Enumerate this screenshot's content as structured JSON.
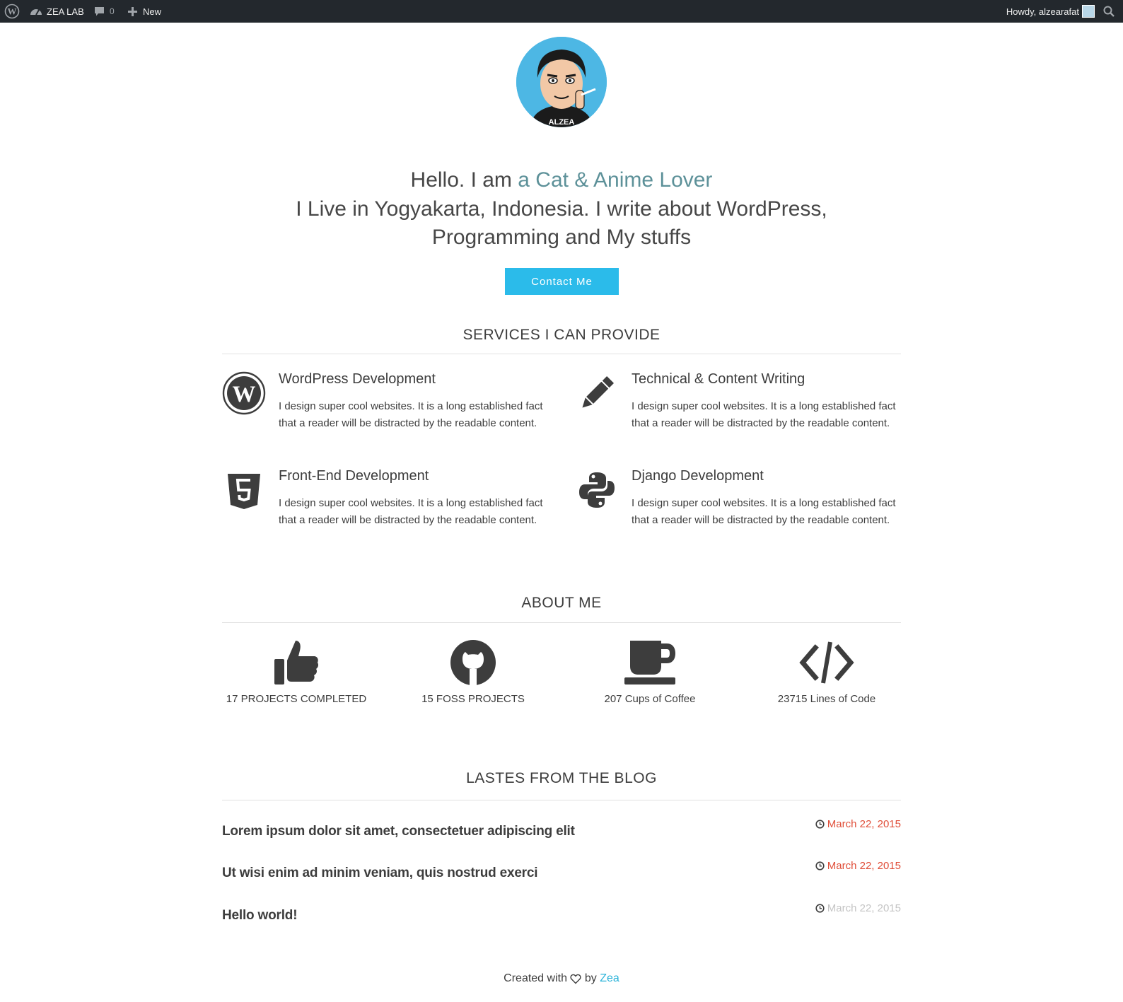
{
  "admin_bar": {
    "site_name": "ZEA LAB",
    "comment_count": "0",
    "new_label": "New",
    "howdy": "Howdy, alzearafat"
  },
  "hero": {
    "greeting": "Hello. I am",
    "role": "a Cat & Anime Lover",
    "line2": "I Live in Yogyakarta, Indonesia. I write about WordPress,",
    "line3": "Programming and My stuffs",
    "button": "Contact Me",
    "avatar_caption": "ALZEA"
  },
  "services": {
    "title": "SERVICES I CAN PROVIDE",
    "items": [
      {
        "title": "WordPress Development",
        "desc": "I design super cool websites. It is a long established fact that a reader will be distracted by the readable content.",
        "icon": "wordpress-icon"
      },
      {
        "title": "Technical & Content Writing",
        "desc": "I design super cool websites. It is a long established fact that a reader will be distracted by the readable content.",
        "icon": "pencil-icon"
      },
      {
        "title": "Front-End Development",
        "desc": "I design super cool websites. It is a long established fact that a reader will be distracted by the readable content.",
        "icon": "html5-icon"
      },
      {
        "title": "Django Development",
        "desc": "I design super cool websites. It is a long established fact that a reader will be distracted by the readable content.",
        "icon": "python-icon"
      }
    ]
  },
  "about": {
    "title": "ABOUT ME",
    "stats": [
      {
        "label": "17 PROJECTS COMPLETED",
        "icon": "thumbs-up-icon"
      },
      {
        "label": "15 FOSS PROJECTS",
        "icon": "github-icon"
      },
      {
        "label": "207 Cups of Coffee",
        "icon": "coffee-icon"
      },
      {
        "label": "23715 Lines of Code",
        "icon": "code-icon"
      }
    ]
  },
  "blog": {
    "title": "LASTES FROM THE BLOG",
    "posts": [
      {
        "title": "Lorem ipsum dolor sit amet, consectetuer adipiscing elit",
        "date": "March 22, 2015"
      },
      {
        "title": "Ut wisi enim ad minim veniam, quis nostrud exerci",
        "date": "March 22, 2015"
      },
      {
        "title": "Hello world!",
        "date": "March 22, 2015"
      }
    ]
  },
  "footer": {
    "created_with": "Created with",
    "by": "by",
    "author": "Zea"
  },
  "colors": {
    "admin_bar": "#23282d",
    "accent_teal": "#5d9199",
    "button_blue": "#2bbbea",
    "date_red": "#e04e39",
    "link_blue": "#2bb3d9"
  }
}
